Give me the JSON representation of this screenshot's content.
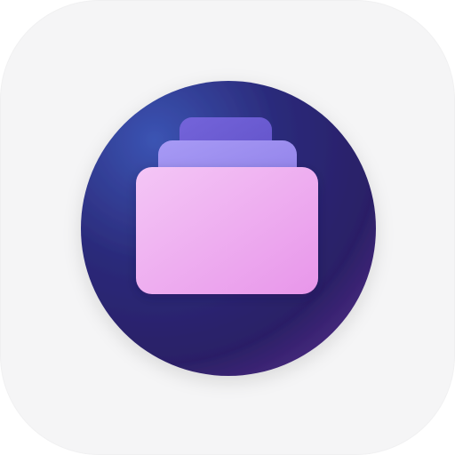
{
  "app_icon": {
    "icon": "stacked-cards-icon",
    "colors": {
      "tile_background": "#f5f5f6",
      "circle_top_left": "#3a4fb0",
      "circle_center": "#2a2372",
      "circle_bottom_right": "#4b2a80",
      "back_card": "#6b5ed6",
      "middle_card": "#9c8cf0",
      "front_card_top": "#f3c4f5",
      "front_card_bottom": "#e898ea"
    }
  }
}
